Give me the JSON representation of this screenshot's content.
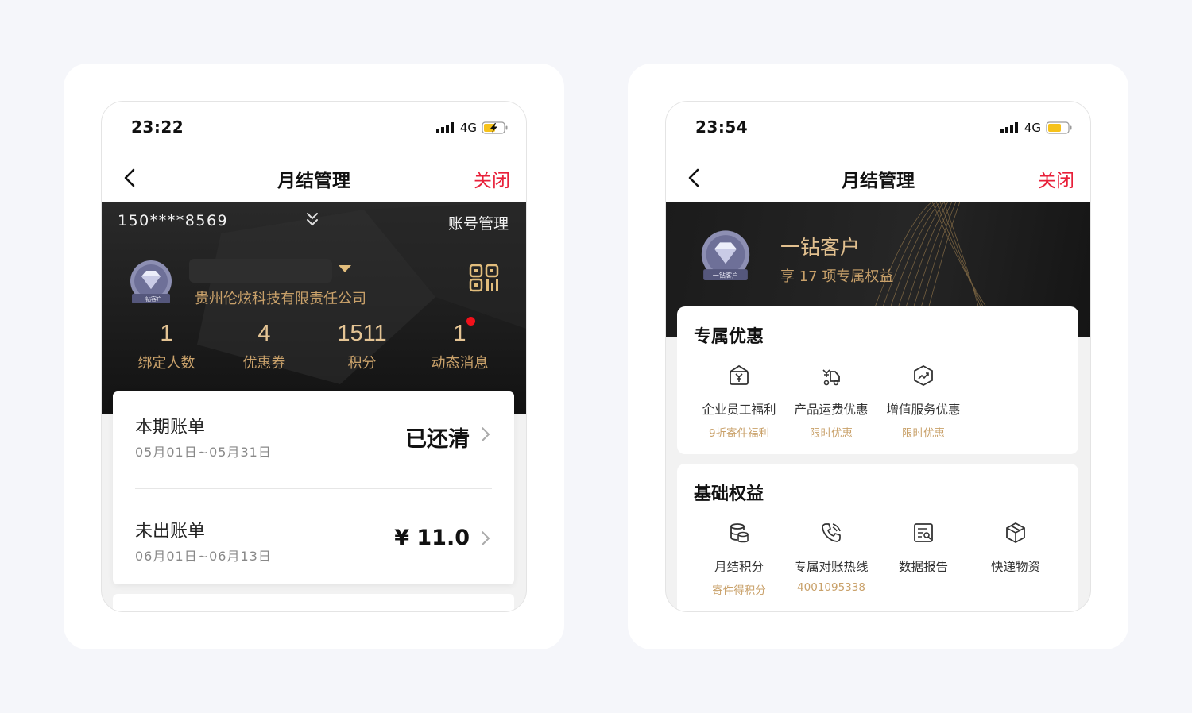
{
  "left_phone": {
    "status": {
      "time": "23:22",
      "network": "4G"
    },
    "nav": {
      "title": "月结管理",
      "close": "关闭"
    },
    "account": {
      "phone": "150****8569",
      "manage": "账号管理",
      "company": "贵州伦炫科技有限责任公司",
      "badge_label": "一钻客户"
    },
    "stats": [
      {
        "value": "1",
        "label": "绑定人数"
      },
      {
        "value": "4",
        "label": "优惠券"
      },
      {
        "value": "1511",
        "label": "积分"
      },
      {
        "value": "1",
        "label": "动态消息"
      }
    ],
    "bills": [
      {
        "name": "本期账单",
        "period": "05月01日~05月31日",
        "value": "已还清"
      },
      {
        "name": "未出账单",
        "period": "06月01日~06月13日",
        "value": "¥ 11.0"
      }
    ]
  },
  "right_phone": {
    "status": {
      "time": "23:54",
      "network": "4G"
    },
    "nav": {
      "title": "月结管理",
      "close": "关闭"
    },
    "tier": {
      "name": "一钻客户",
      "subtitle": "享 17 项专属权益",
      "badge_label": "一钻客户"
    },
    "exclusive": {
      "title": "专属优惠",
      "items": [
        {
          "icon": "wallet-yen-icon",
          "name": "企业员工福利",
          "sub": "9折寄件福利"
        },
        {
          "icon": "delivery-cart-icon",
          "name": "产品运费优惠",
          "sub": "限时优惠"
        },
        {
          "icon": "growth-hexagon-icon",
          "name": "增值服务优惠",
          "sub": "限时优惠"
        }
      ]
    },
    "basic": {
      "title": "基础权益",
      "items": [
        {
          "icon": "coin-stack-icon",
          "name": "月结积分",
          "sub": "寄件得积分"
        },
        {
          "icon": "phone-call-icon",
          "name": "专属对账热线",
          "sub": "4001095338"
        },
        {
          "icon": "report-icon",
          "name": "数据报告",
          "sub": ""
        },
        {
          "icon": "package-icon",
          "name": "快递物资",
          "sub": ""
        }
      ]
    }
  },
  "colors": {
    "accent_red": "#e8203a",
    "gold": "#c9a16a",
    "dark": "#1d1d1d",
    "notify": "#f1111b"
  }
}
